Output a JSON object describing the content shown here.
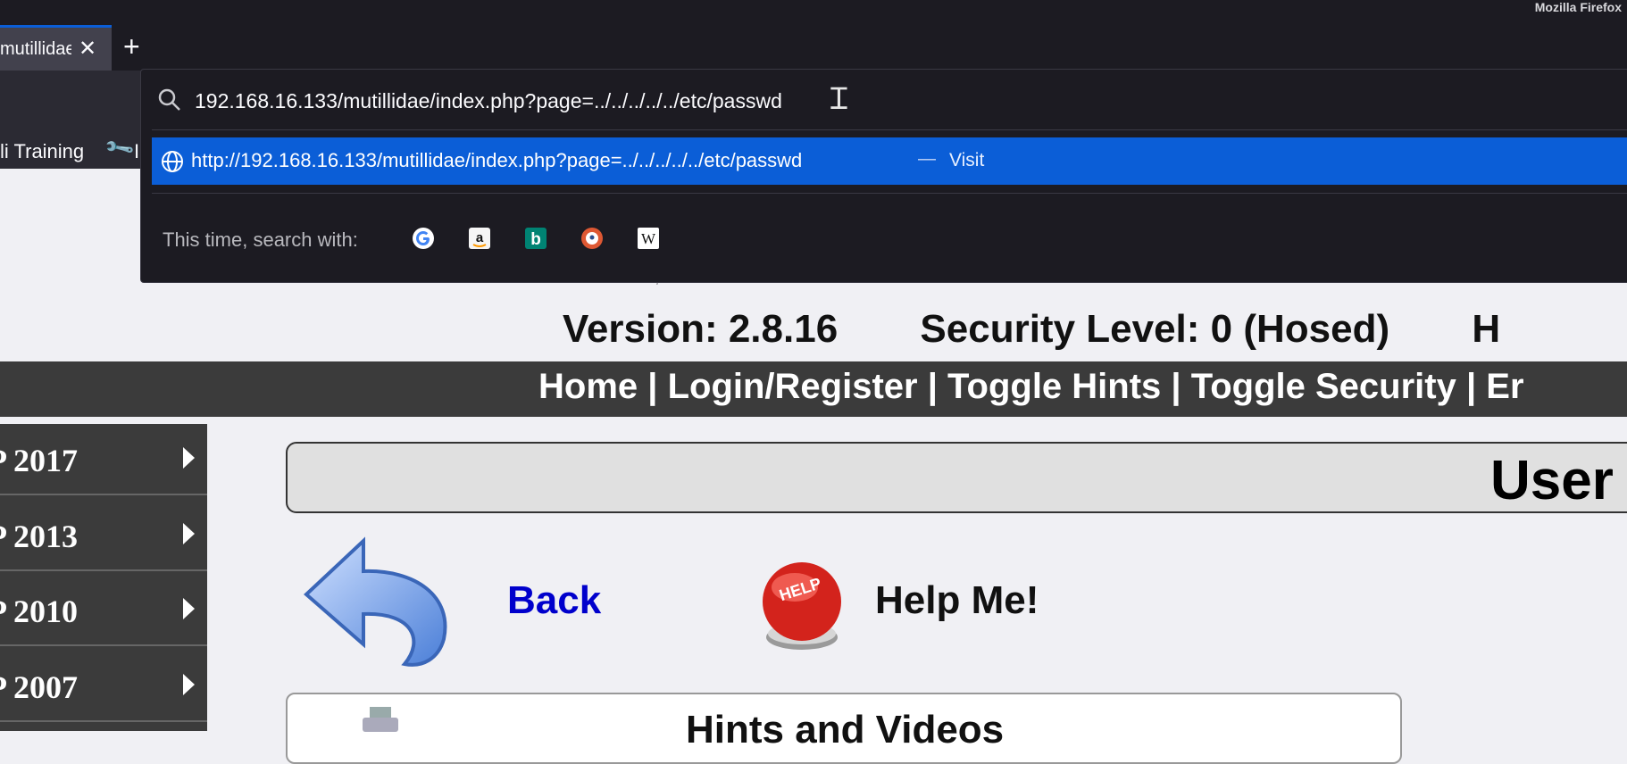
{
  "window": {
    "title": "Mozilla Firefox"
  },
  "tab": {
    "title": "mutillidae",
    "close_icon": "close-icon"
  },
  "toolbar": {
    "bookmark_label": "li Training",
    "bookmark_more": "I"
  },
  "urlbar": {
    "value": "192.168.16.133/mutillidae/index.php?page=../../../../../etc/passwd",
    "suggestion": {
      "url": "http://192.168.16.133/mutillidae/index.php?page=../../../../../etc/passwd",
      "separator": "—",
      "action": "Visit"
    },
    "search_with_label": "This time, search with:",
    "engines": [
      "google-icon",
      "amazon-icon",
      "bing-icon",
      "duckduckgo-icon",
      "wikipedia-icon"
    ]
  },
  "page": {
    "version": "Version: 2.8.16",
    "security_level": "Security Level: 0 (Hosed)",
    "extra_header": "H",
    "nav": {
      "home": "Home",
      "login": "Login/Register",
      "hints": "Toggle Hints",
      "security": "Toggle Security",
      "more": "Er"
    },
    "sidebar": [
      {
        "label": "P 2017"
      },
      {
        "label": "P 2013"
      },
      {
        "label": "P 2010"
      },
      {
        "label": "P 2007"
      }
    ],
    "title": "User",
    "back_label": "Back",
    "help_label": "Help Me!",
    "help_button_text": "HELP",
    "hints_title": "Hints and Videos"
  },
  "colors": {
    "accent": "#0b5ed7",
    "chrome": "#1c1b22",
    "nav_bg": "#3b3b3b",
    "link": "#0000cc"
  }
}
